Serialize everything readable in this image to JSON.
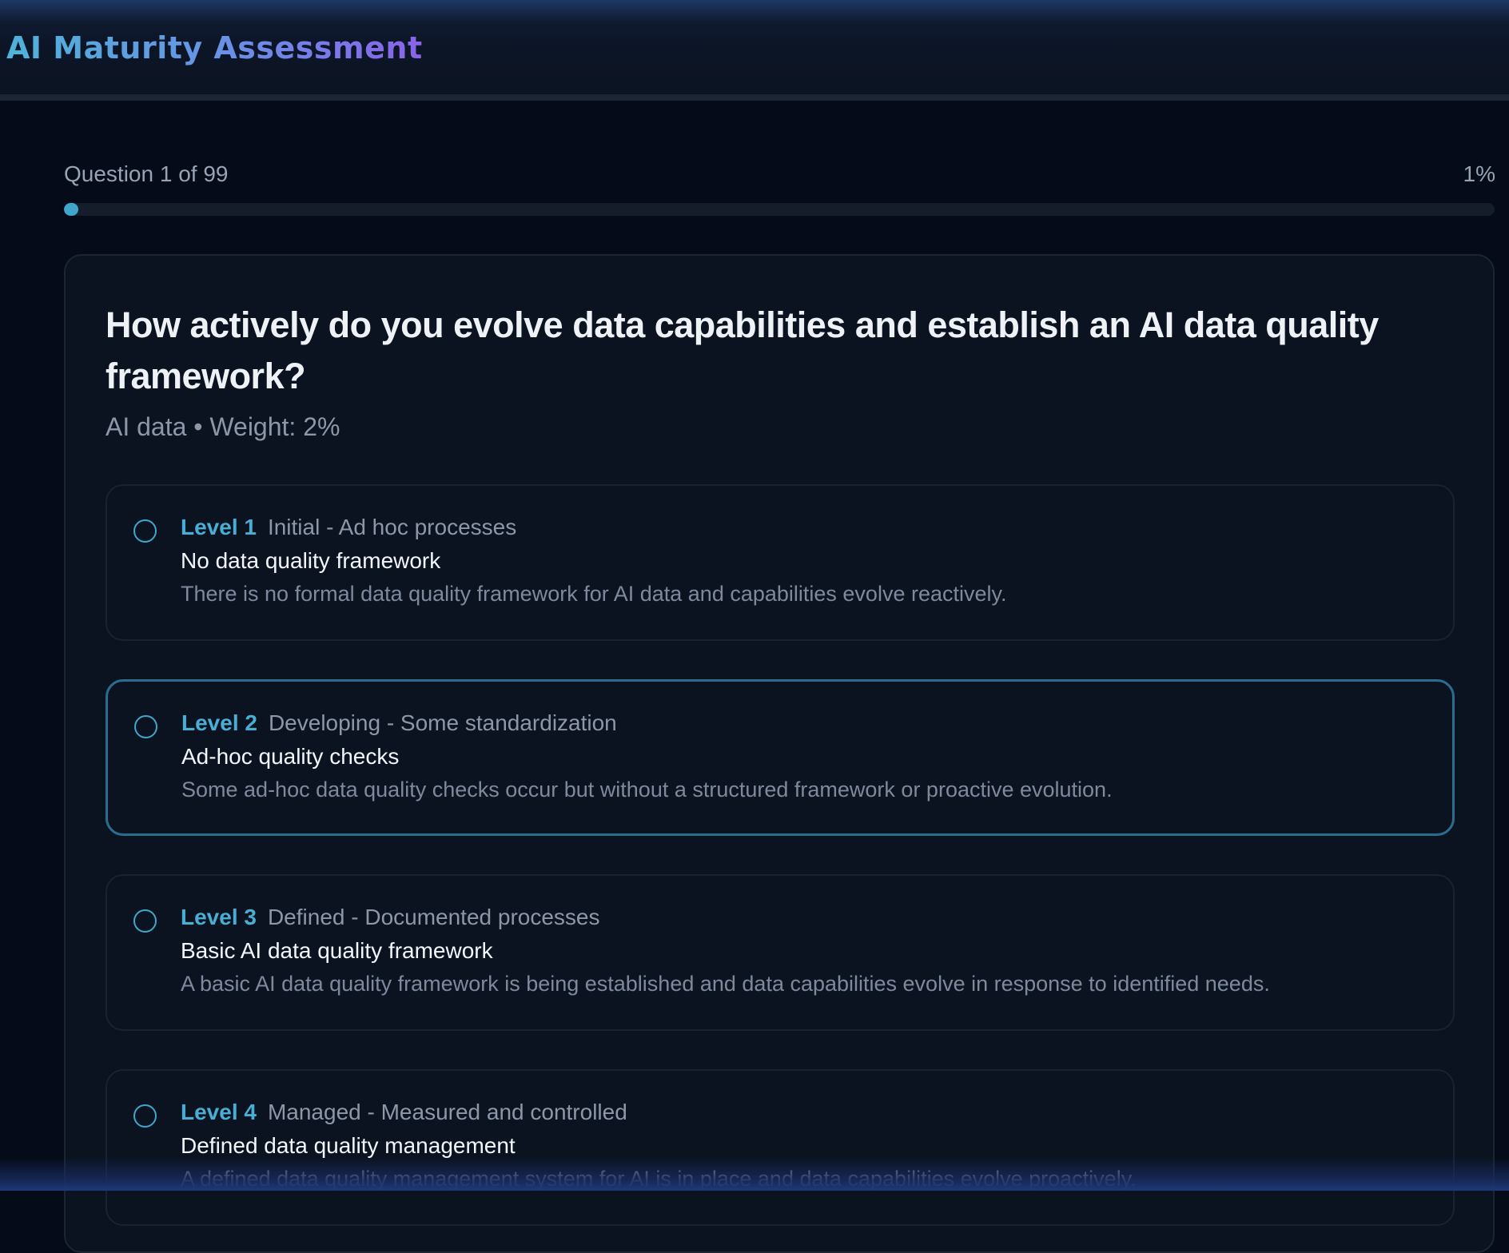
{
  "app": {
    "title": "AI Maturity Assessment"
  },
  "progress": {
    "label": "Question 1 of 99",
    "percent_label": "1%",
    "fraction": 0.01
  },
  "question": {
    "text": "How actively do you evolve data capabilities and establish an AI data quality framework?",
    "meta": "AI data • Weight: 2%"
  },
  "options": [
    {
      "level": "Level 1",
      "level_desc": "Initial - Ad hoc processes",
      "title": "No data quality framework",
      "description": "There is no formal data quality framework for AI data and capabilities evolve reactively."
    },
    {
      "level": "Level 2",
      "level_desc": "Developing - Some standardization",
      "title": "Ad-hoc quality checks",
      "description": "Some ad-hoc data quality checks occur but without a structured framework or proactive evolution."
    },
    {
      "level": "Level 3",
      "level_desc": "Defined - Documented processes",
      "title": "Basic AI data quality framework",
      "description": "A basic AI data quality framework is being established and data capabilities evolve in response to identified needs."
    },
    {
      "level": "Level 4",
      "level_desc": "Managed - Measured and controlled",
      "title": "Defined data quality management",
      "description": "A defined data quality management system for AI is in place and data capabilities evolve proactively."
    }
  ],
  "colors": {
    "accent": "#3fa7cc",
    "background": "#050b18",
    "card": "#0b1321"
  }
}
